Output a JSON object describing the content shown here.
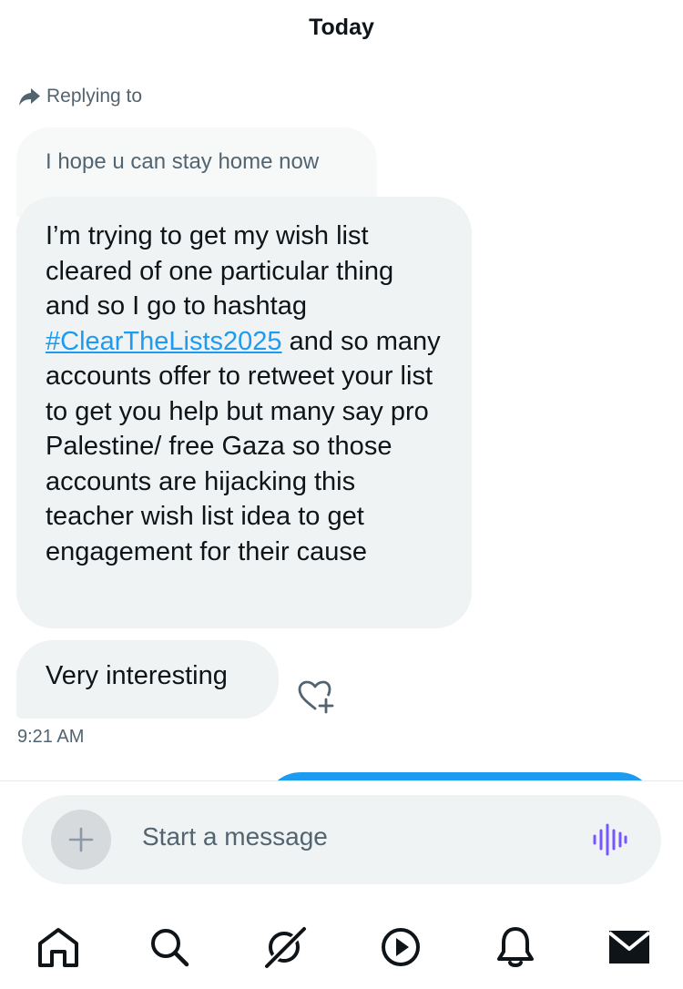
{
  "header": {
    "date": "Today"
  },
  "thread": {
    "replying_to_label": "Replying to",
    "quoted_text": "I hope u can stay home now",
    "main_message": {
      "text_before": "I’m trying to get my wish list cleared of one particular thing and so I go to hashtag ",
      "hashtag": "#ClearTheLists2025",
      "text_after": " and so many accounts offer to retweet your list to get you help but many say pro Palestine/ free Gaza so those accounts are hijacking this teacher wish list idea to get engagement for their cause"
    },
    "short_message": "Very interesting",
    "timestamp": "9:21 AM"
  },
  "composer": {
    "placeholder": "Start a message",
    "add_icon": "plus-icon",
    "voice_icon": "voice-wave-icon"
  },
  "nav": {
    "items": [
      {
        "icon": "home-icon"
      },
      {
        "icon": "search-icon"
      },
      {
        "icon": "grok-icon"
      },
      {
        "icon": "play-icon"
      },
      {
        "icon": "bell-icon"
      },
      {
        "icon": "mail-icon"
      }
    ]
  },
  "colors": {
    "bubble": "#eff3f4",
    "accent": "#1d9bf0",
    "secondary_text": "#536471",
    "voice": "#7856ff"
  }
}
